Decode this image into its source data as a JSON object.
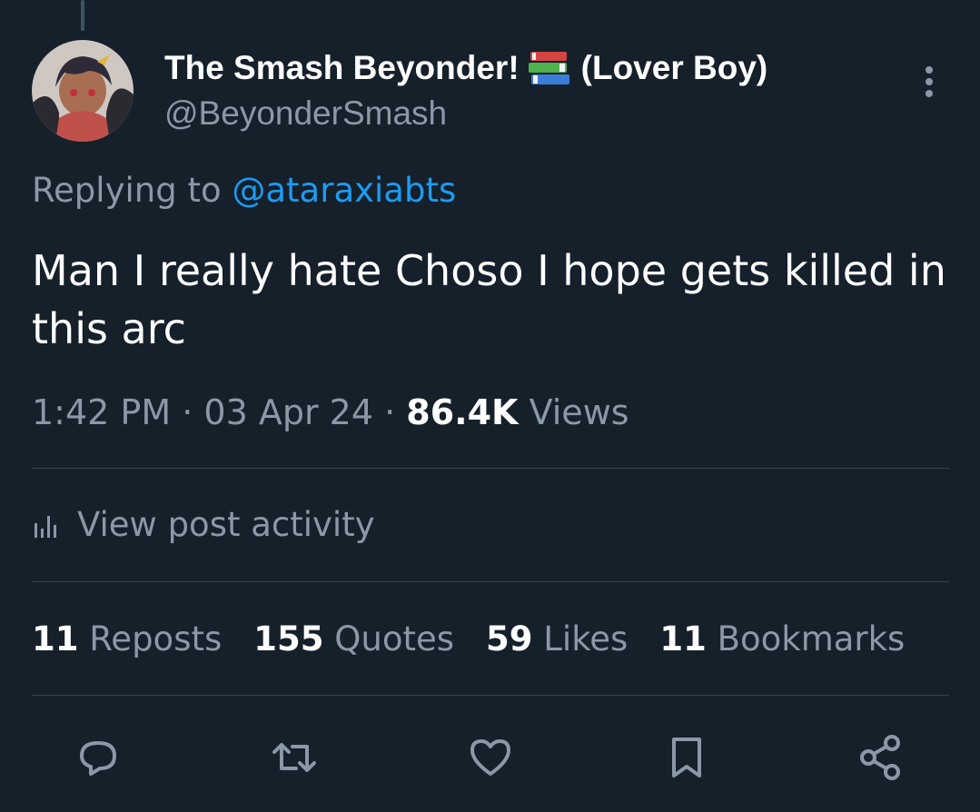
{
  "tweet": {
    "display_name": "The Smash Beyonder!",
    "display_name_suffix": "(Lover Boy)",
    "handle": "@BeyonderSmash",
    "replying_prefix": "Replying to",
    "replying_to": "@ataraxiabts",
    "text": "Man I really hate Choso I hope gets killed in this arc",
    "time": "1:42 PM",
    "date": "03 Apr 24",
    "views_count": "86.4K",
    "views_label": "Views"
  },
  "activity": {
    "label": "View post activity",
    "icon": "bar-chart-icon"
  },
  "stats": [
    {
      "num": "11",
      "label": "Reposts"
    },
    {
      "num": "155",
      "label": "Quotes"
    },
    {
      "num": "59",
      "label": "Likes"
    },
    {
      "num": "11",
      "label": "Bookmarks"
    }
  ],
  "actions": [
    {
      "name": "reply",
      "icon": "reply-icon"
    },
    {
      "name": "repost",
      "icon": "repost-icon"
    },
    {
      "name": "like",
      "icon": "heart-icon"
    },
    {
      "name": "bookmark",
      "icon": "bookmark-icon"
    },
    {
      "name": "share",
      "icon": "share-icon"
    }
  ],
  "colors": {
    "background": "#15202b",
    "secondary_text": "#8b98a5",
    "link": "#1d9bf0",
    "divider": "#38444d"
  }
}
